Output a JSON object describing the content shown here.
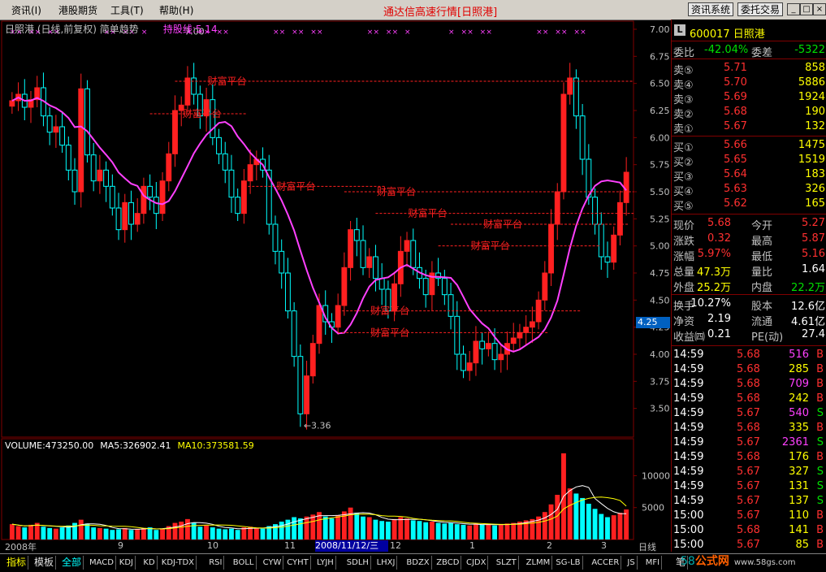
{
  "menu": {
    "items": [
      "资讯(I)",
      "港股期货",
      "工具(T)",
      "帮助(H)"
    ],
    "title": "通达信高速行情[日照港]",
    "buttons": [
      "资讯系统",
      "委托交易"
    ],
    "window_controls": [
      "_",
      "□",
      "×"
    ]
  },
  "chart_header": {
    "text": "日照港 (日线,前复权) 简单趋势",
    "hold_line": "持股线:5.14",
    "high_label": "7.00",
    "low_label": "←3.36"
  },
  "volume_header": {
    "volume": "VOLUME:473250.00",
    "ma5": "MA5:326902.41",
    "ma10": "MA10:373581.59"
  },
  "platform_label": "财富平台",
  "x_axis": {
    "labels": [
      "2008年",
      "9",
      "10",
      "11",
      "12",
      "1",
      "2",
      "3"
    ],
    "highlight_date": "2008/11/12/三",
    "period": "日线"
  },
  "current_price_tag": "4.25",
  "chart_data": [
    {
      "type": "candlestick",
      "title": "日照港 (日线,前复权) 简单趋势",
      "ylim": [
        3.25,
        7.0
      ],
      "y_ticks": [
        7.0,
        6.75,
        6.5,
        6.25,
        6.0,
        5.75,
        5.5,
        5.25,
        5.0,
        4.75,
        4.5,
        4.25,
        4.0,
        3.75,
        3.5
      ],
      "high": 7.0,
      "low": 3.36,
      "series": [
        {
          "name": "持股线",
          "value": 5.14
        }
      ],
      "close": [
        6.34,
        6.4,
        6.28,
        6.35,
        6.46,
        6.2,
        6.05,
        6.1,
        5.93,
        5.7,
        5.5,
        6.45,
        5.84,
        5.6,
        5.7,
        5.55,
        5.35,
        5.15,
        5.4,
        5.2,
        5.3,
        5.55,
        5.45,
        5.3,
        5.6,
        5.85,
        6.25,
        6.3,
        6.55,
        6.4,
        6.2,
        6.35,
        6.0,
        5.85,
        5.7,
        5.45,
        5.3,
        5.6,
        5.75,
        5.8,
        5.7,
        5.2,
        4.95,
        4.75,
        4.4,
        3.98,
        3.45,
        3.8,
        4.1,
        4.45,
        4.3,
        4.25,
        4.45,
        4.8,
        5.15,
        5.05,
        4.8,
        4.9,
        4.7,
        4.6,
        4.4,
        4.65,
        4.95,
        5.05,
        4.8,
        4.7,
        4.55,
        4.75,
        4.7,
        4.55,
        4.35,
        4.0,
        3.85,
        3.92,
        4.12,
        4.05,
        4.1,
        3.95,
        4.0,
        4.1,
        4.15,
        4.2,
        4.25,
        4.3,
        4.5,
        4.75,
        5.2,
        5.5,
        6.4,
        6.55,
        6.2,
        5.8,
        5.45,
        5.2,
        4.9,
        4.85,
        5.1,
        5.4,
        5.68
      ],
      "volume_ylim": [
        0,
        14000
      ],
      "volume_ticks": [
        10000,
        5000
      ],
      "volume": [
        2400,
        2100,
        1900,
        2300,
        2600,
        2000,
        1800,
        1700,
        1900,
        2200,
        2600,
        3100,
        2500,
        1900,
        1800,
        1700,
        1500,
        1600,
        1800,
        1500,
        1600,
        1800,
        1900,
        1500,
        1700,
        2100,
        2600,
        2800,
        3200,
        2600,
        2000,
        2200,
        1900,
        1700,
        1600,
        1700,
        1500,
        1900,
        2000,
        1800,
        1700,
        2100,
        2400,
        2800,
        3100,
        3500,
        3300,
        3600,
        3900,
        4300,
        3600,
        3300,
        3800,
        4400,
        5000,
        4200,
        3600,
        3500,
        3100,
        2900,
        2800,
        3200,
        3500,
        3300,
        3000,
        2900,
        2700,
        2800,
        2600,
        2500,
        2600,
        2400,
        2300,
        2200,
        2500,
        2300,
        2400,
        2200,
        2300,
        2500,
        2600,
        2800,
        3000,
        3200,
        3600,
        4300,
        5500,
        7000,
        13500,
        8000,
        7200,
        6500,
        5600,
        4800,
        4000,
        3500,
        3800,
        4200,
        4700
      ]
    }
  ],
  "quote": {
    "code": "600017",
    "name": "日照港",
    "commission_ratio_label": "委比",
    "commission_ratio": "-42.04%",
    "commission_diff_label": "委差",
    "commission_diff": "-5322",
    "asks": [
      {
        "label": "卖⑤",
        "price": "5.71",
        "vol": "858"
      },
      {
        "label": "卖④",
        "price": "5.70",
        "vol": "5886"
      },
      {
        "label": "卖③",
        "price": "5.69",
        "vol": "1924"
      },
      {
        "label": "卖②",
        "price": "5.68",
        "vol": "190"
      },
      {
        "label": "卖①",
        "price": "5.67",
        "vol": "132"
      }
    ],
    "bids": [
      {
        "label": "买①",
        "price": "5.66",
        "vol": "1475"
      },
      {
        "label": "买②",
        "price": "5.65",
        "vol": "1519"
      },
      {
        "label": "买③",
        "price": "5.64",
        "vol": "183"
      },
      {
        "label": "买④",
        "price": "5.63",
        "vol": "326"
      },
      {
        "label": "买⑤",
        "price": "5.62",
        "vol": "165"
      }
    ],
    "stats": [
      {
        "l1": "现价",
        "v1": "5.68",
        "l2": "今开",
        "v2": "5.27"
      },
      {
        "l1": "涨跌",
        "v1": "0.32",
        "l2": "最高",
        "v2": "5.87"
      },
      {
        "l1": "涨幅",
        "v1": "5.97%",
        "l2": "最低",
        "v2": "5.16"
      },
      {
        "l1": "总量",
        "v1": "47.3万",
        "l2": "量比",
        "v2": "1.64"
      },
      {
        "l1": "外盘",
        "v1": "25.2万",
        "l2": "内盘",
        "v2": "22.2万"
      }
    ],
    "stats2": [
      {
        "l1": "换手",
        "v1": "10.27%",
        "l2": "股本",
        "v2": "12.6亿"
      },
      {
        "l1": "净资",
        "v1": "2.19",
        "l2": "流通",
        "v2": "4.61亿"
      },
      {
        "l1": "收益㈣",
        "v1": "0.21",
        "l2": "PE(动)",
        "v2": "27.4"
      }
    ],
    "ticks": [
      {
        "t": "14:59",
        "p": "5.68",
        "v": "516",
        "s": "B"
      },
      {
        "t": "14:59",
        "p": "5.68",
        "v": "285",
        "s": "B"
      },
      {
        "t": "14:59",
        "p": "5.68",
        "v": "709",
        "s": "B"
      },
      {
        "t": "14:59",
        "p": "5.68",
        "v": "242",
        "s": "B"
      },
      {
        "t": "14:59",
        "p": "5.67",
        "v": "540",
        "s": "S"
      },
      {
        "t": "14:59",
        "p": "5.68",
        "v": "335",
        "s": "B"
      },
      {
        "t": "14:59",
        "p": "5.67",
        "v": "2361",
        "s": "S"
      },
      {
        "t": "14:59",
        "p": "5.68",
        "v": "176",
        "s": "B"
      },
      {
        "t": "14:59",
        "p": "5.67",
        "v": "327",
        "s": "S"
      },
      {
        "t": "14:59",
        "p": "5.67",
        "v": "131",
        "s": "S"
      },
      {
        "t": "14:59",
        "p": "5.67",
        "v": "137",
        "s": "S"
      },
      {
        "t": "15:00",
        "p": "5.67",
        "v": "110",
        "s": "B"
      },
      {
        "t": "15:00",
        "p": "5.68",
        "v": "141",
        "s": "B"
      },
      {
        "t": "15:00",
        "p": "5.67",
        "v": "85",
        "s": "B"
      }
    ]
  },
  "tabs": [
    "指标",
    "模板",
    "全部",
    "MACD",
    "KDJ",
    "KD",
    "KDJ-TDX",
    "RSI",
    "BOLL",
    "CYW",
    "CYHT",
    "LYJH",
    "SDLH",
    "LHXJ",
    "BDZX",
    "ZBCD",
    "CJDX",
    "SLZT",
    "ZLMM",
    "SG-LB",
    "ACCER",
    "JS",
    "MFI"
  ],
  "tab_right": "笔",
  "watermark": {
    "w1": "58",
    "w2": "公式网",
    "w3": "www.58gs.com"
  },
  "colors": {
    "up": "#ff2020",
    "down": "#00ffff",
    "ma": "#ff40ff",
    "platform": "#ff2020",
    "axis": "#800000"
  }
}
